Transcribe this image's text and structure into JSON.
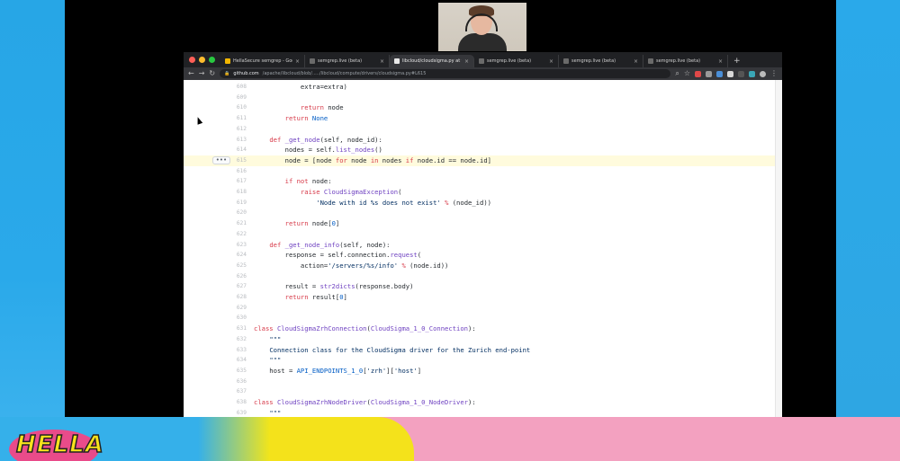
{
  "colors": {
    "accent_blue": "#2aa9ea",
    "accent_yellow": "#f4e21b",
    "accent_pink": "#f3a1c0",
    "browser_dark": "#202124"
  },
  "logo_text": "HELLA",
  "browser": {
    "tabs": [
      {
        "label": "HellaSecure semgrep - Google",
        "icon": "doc-icon",
        "active": false
      },
      {
        "label": "semgrep.live (beta)",
        "icon": "semgrep-icon",
        "active": false
      },
      {
        "label": "libcloud/cloudsigma.py at tr",
        "icon": "github-icon",
        "active": true
      },
      {
        "label": "semgrep.live (beta)",
        "icon": "semgrep-icon",
        "active": false
      },
      {
        "label": "semgrep.live (beta)",
        "icon": "semgrep-icon",
        "active": false
      },
      {
        "label": "semgrep.live (beta)",
        "icon": "semgrep-icon",
        "active": false
      }
    ],
    "new_tab": "+",
    "url_domain": "github.com",
    "url_path": "/apache/libcloud/blob/...../libcloud/compute/drivers/cloudsigma.py#L615"
  },
  "code": {
    "highlight_line": "615",
    "lines": [
      {
        "n": "608",
        "t": [
          {
            "s": "            extra=extra)"
          }
        ]
      },
      {
        "n": "609",
        "t": []
      },
      {
        "n": "610",
        "t": [
          {
            "s": "            "
          },
          {
            "s": "return",
            "c": "kw"
          },
          {
            "s": " node"
          }
        ]
      },
      {
        "n": "611",
        "t": [
          {
            "s": "        "
          },
          {
            "s": "return",
            "c": "kw"
          },
          {
            "s": " "
          },
          {
            "s": "None",
            "c": "builtin"
          }
        ]
      },
      {
        "n": "612",
        "t": []
      },
      {
        "n": "613",
        "t": [
          {
            "s": "    "
          },
          {
            "s": "def",
            "c": "kw"
          },
          {
            "s": " "
          },
          {
            "s": "_get_node",
            "c": "fn"
          },
          {
            "s": "(self, node_id):"
          }
        ]
      },
      {
        "n": "614",
        "t": [
          {
            "s": "        nodes = self."
          },
          {
            "s": "list_nodes",
            "c": "fn"
          },
          {
            "s": "()"
          }
        ]
      },
      {
        "n": "615",
        "t": [
          {
            "s": "        node = [node "
          },
          {
            "s": "for",
            "c": "kw"
          },
          {
            "s": " node "
          },
          {
            "s": "in",
            "c": "kw"
          },
          {
            "s": " nodes "
          },
          {
            "s": "if",
            "c": "kw"
          },
          {
            "s": " node.id == node.id]"
          }
        ]
      },
      {
        "n": "616",
        "t": []
      },
      {
        "n": "617",
        "t": [
          {
            "s": "        "
          },
          {
            "s": "if",
            "c": "kw"
          },
          {
            "s": " "
          },
          {
            "s": "not",
            "c": "kw"
          },
          {
            "s": " node:"
          }
        ]
      },
      {
        "n": "618",
        "t": [
          {
            "s": "            "
          },
          {
            "s": "raise",
            "c": "kw"
          },
          {
            "s": " "
          },
          {
            "s": "CloudSigmaException",
            "c": "fn"
          },
          {
            "s": "("
          }
        ]
      },
      {
        "n": "619",
        "t": [
          {
            "s": "                "
          },
          {
            "s": "'Node with id %s does not exist'",
            "c": "str"
          },
          {
            "s": " "
          },
          {
            "s": "%",
            "c": "kw"
          },
          {
            "s": " (node_id))"
          }
        ]
      },
      {
        "n": "620",
        "t": []
      },
      {
        "n": "621",
        "t": [
          {
            "s": "        "
          },
          {
            "s": "return",
            "c": "kw"
          },
          {
            "s": " node["
          },
          {
            "s": "0",
            "c": "num"
          },
          {
            "s": "]"
          }
        ]
      },
      {
        "n": "622",
        "t": []
      },
      {
        "n": "623",
        "t": [
          {
            "s": "    "
          },
          {
            "s": "def",
            "c": "kw"
          },
          {
            "s": " "
          },
          {
            "s": "_get_node_info",
            "c": "fn"
          },
          {
            "s": "(self, node):"
          }
        ]
      },
      {
        "n": "624",
        "t": [
          {
            "s": "        response = self.connection."
          },
          {
            "s": "request",
            "c": "fn"
          },
          {
            "s": "("
          }
        ]
      },
      {
        "n": "625",
        "t": [
          {
            "s": "            action="
          },
          {
            "s": "'/servers/%s/info'",
            "c": "str"
          },
          {
            "s": " "
          },
          {
            "s": "%",
            "c": "kw"
          },
          {
            "s": " (node.id))"
          }
        ]
      },
      {
        "n": "626",
        "t": []
      },
      {
        "n": "627",
        "t": [
          {
            "s": "        result = "
          },
          {
            "s": "str2dicts",
            "c": "fn"
          },
          {
            "s": "(response.body)"
          }
        ]
      },
      {
        "n": "628",
        "t": [
          {
            "s": "        "
          },
          {
            "s": "return",
            "c": "kw"
          },
          {
            "s": " result["
          },
          {
            "s": "0",
            "c": "num"
          },
          {
            "s": "]"
          }
        ]
      },
      {
        "n": "629",
        "t": []
      },
      {
        "n": "630",
        "t": []
      },
      {
        "n": "631",
        "t": [
          {
            "s": "class",
            "c": "kw"
          },
          {
            "s": " "
          },
          {
            "s": "CloudSigmaZrhConnection",
            "c": "fn"
          },
          {
            "s": "("
          },
          {
            "s": "CloudSigma_1_0_Connection",
            "c": "fn"
          },
          {
            "s": "):"
          }
        ]
      },
      {
        "n": "632",
        "t": [
          {
            "s": "    "
          },
          {
            "s": "\"\"\"",
            "c": "str"
          }
        ]
      },
      {
        "n": "633",
        "t": [
          {
            "s": "    "
          },
          {
            "s": "Connection class for the CloudSigma driver for the Zurich end-point",
            "c": "str"
          }
        ]
      },
      {
        "n": "634",
        "t": [
          {
            "s": "    "
          },
          {
            "s": "\"\"\"",
            "c": "str"
          }
        ]
      },
      {
        "n": "635",
        "t": [
          {
            "s": "    host = "
          },
          {
            "s": "API_ENDPOINTS_1_0",
            "c": "builtin"
          },
          {
            "s": "["
          },
          {
            "s": "'zrh'",
            "c": "str"
          },
          {
            "s": "]["
          },
          {
            "s": "'host'",
            "c": "str"
          },
          {
            "s": "]"
          }
        ]
      },
      {
        "n": "636",
        "t": []
      },
      {
        "n": "637",
        "t": []
      },
      {
        "n": "638",
        "t": [
          {
            "s": "class",
            "c": "kw"
          },
          {
            "s": " "
          },
          {
            "s": "CloudSigmaZrhNodeDriver",
            "c": "fn"
          },
          {
            "s": "("
          },
          {
            "s": "CloudSigma_1_0_NodeDriver",
            "c": "fn"
          },
          {
            "s": "):"
          }
        ]
      },
      {
        "n": "639",
        "t": [
          {
            "s": "    "
          },
          {
            "s": "\"\"\"",
            "c": "str"
          }
        ]
      }
    ]
  },
  "line_menu": "•••"
}
